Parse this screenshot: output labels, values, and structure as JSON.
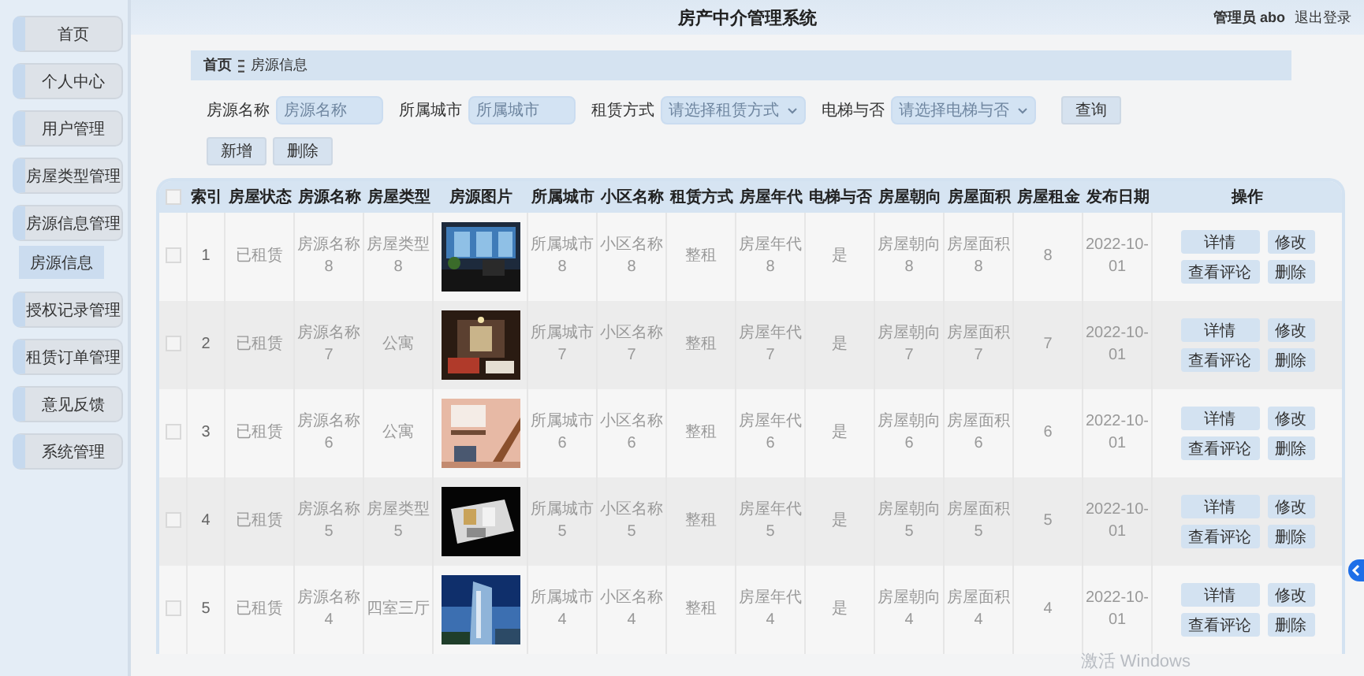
{
  "header": {
    "title": "房产中介管理系统",
    "user": "管理员 abo",
    "logout": "退出登录"
  },
  "sidebar": {
    "items": [
      {
        "label": "首页",
        "selected": false
      },
      {
        "label": "个人中心",
        "selected": false
      },
      {
        "label": "用户管理",
        "selected": false
      },
      {
        "label": "房屋类型管理",
        "selected": false
      },
      {
        "label": "房源信息管理",
        "selected": false,
        "expanded": true,
        "children": [
          {
            "label": "房源信息",
            "selected": true
          }
        ]
      },
      {
        "label": "授权记录管理",
        "selected": false
      },
      {
        "label": "租赁订单管理",
        "selected": false
      },
      {
        "label": "意见反馈",
        "selected": false
      },
      {
        "label": "系统管理",
        "selected": false
      }
    ]
  },
  "breadcrumb": [
    "首页",
    "房源信息"
  ],
  "search": {
    "fields": [
      {
        "kind": "input",
        "label": "房源名称",
        "placeholder": "房源名称"
      },
      {
        "kind": "input",
        "label": "所属城市",
        "placeholder": "所属城市"
      },
      {
        "kind": "select",
        "label": "租赁方式",
        "placeholder": "请选择租赁方式"
      },
      {
        "kind": "select",
        "label": "电梯与否",
        "placeholder": "请选择电梯与否"
      }
    ],
    "button": "查询"
  },
  "actions": [
    "新增",
    "删除"
  ],
  "table": {
    "select_all_checked": false,
    "columns": [
      "索引",
      "房屋状态",
      "房源名称",
      "房屋类型",
      "房源图片",
      "所属城市",
      "小区名称",
      "租赁方式",
      "房屋年代",
      "电梯与否",
      "房屋朝向",
      "房屋面积",
      "房屋租金",
      "发布日期",
      "操作"
    ],
    "rows": [
      {
        "checked": false,
        "cells": [
          "1",
          "已租赁",
          "房源名称 8",
          "房屋类型 8",
          {
            "kind": "picture"
          },
          "所属城市 8",
          "小区名称 8",
          "整租",
          "房屋年代 8",
          "是",
          "房屋朝向 8",
          "房屋面积 8",
          "8",
          "2022-10-01"
        ],
        "actions": [
          "详情",
          "修改",
          "查看评论",
          "删除"
        ]
      },
      {
        "checked": false,
        "cells": [
          "2",
          "已租赁",
          "房源名称 7",
          "公寓",
          {
            "kind": "picture"
          },
          "所属城市 7",
          "小区名称 7",
          "整租",
          "房屋年代 7",
          "是",
          "房屋朝向 7",
          "房屋面积 7",
          "7",
          "2022-10-01"
        ],
        "actions": [
          "详情",
          "修改",
          "查看评论",
          "删除"
        ]
      },
      {
        "checked": false,
        "cells": [
          "3",
          "已租赁",
          "房源名称 6",
          "公寓",
          {
            "kind": "picture"
          },
          "所属城市 6",
          "小区名称 6",
          "整租",
          "房屋年代 6",
          "是",
          "房屋朝向 6",
          "房屋面积 6",
          "6",
          "2022-10-01"
        ],
        "actions": [
          "详情",
          "修改",
          "查看评论",
          "删除"
        ]
      },
      {
        "checked": false,
        "cells": [
          "4",
          "已租赁",
          "房源名称 5",
          "房屋类型 5",
          {
            "kind": "picture"
          },
          "所属城市 5",
          "小区名称 5",
          "整租",
          "房屋年代 5",
          "是",
          "房屋朝向 5",
          "房屋面积 5",
          "5",
          "2022-10-01"
        ],
        "actions": [
          "详情",
          "修改",
          "查看评论",
          "删除"
        ]
      },
      {
        "checked": false,
        "cells": [
          "5",
          "已租赁",
          "房源名称 4",
          "四室三厅",
          {
            "kind": "picture"
          },
          "所属城市 4",
          "小区名称 4",
          "整租",
          "房屋年代 4",
          "是",
          "房屋朝向 4",
          "房屋面积 4",
          "4",
          "2022-10-01"
        ],
        "actions": [
          "详情",
          "修改",
          "查看评论",
          "删除"
        ]
      }
    ]
  },
  "os_notice": "激活 Windows"
}
